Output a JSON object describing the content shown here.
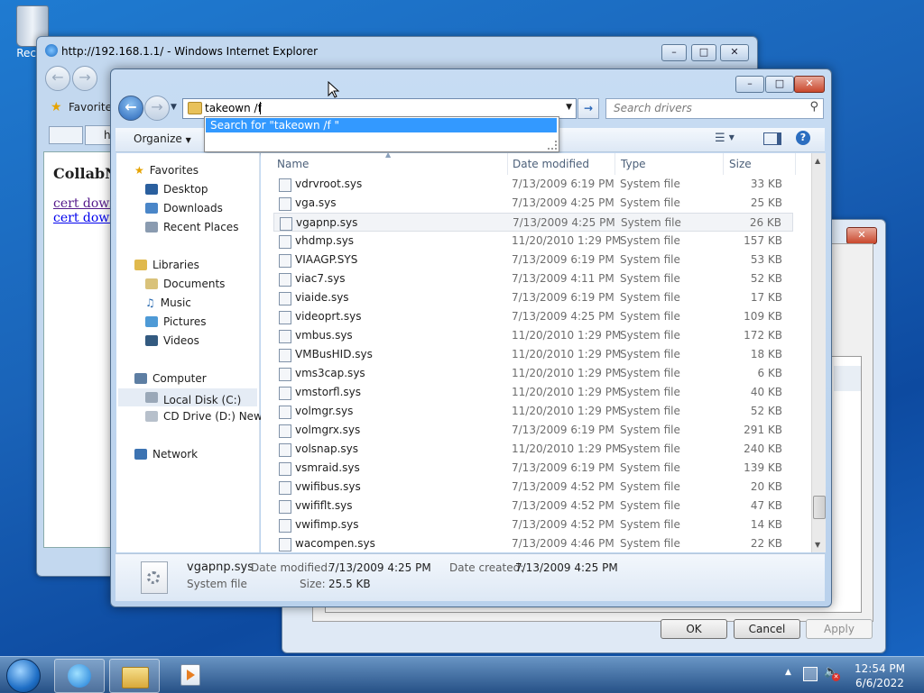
{
  "desktop": {
    "recycle_label": "Recyc"
  },
  "ie": {
    "title": "http://192.168.1.1/ - Windows Internet Explorer",
    "favorites_label": "Favorites",
    "tab_label": "h",
    "heading": "CollabN",
    "links": [
      "cert downl",
      "cert downl"
    ]
  },
  "props": {
    "ok": "OK",
    "cancel": "Cancel",
    "apply": "Apply"
  },
  "explorer": {
    "address_text": "takeown /f ",
    "search_placeholder": "Search drivers",
    "suggestion": "Search for \"takeown /f \"",
    "toolbar": {
      "organize": "Organize"
    },
    "nav": {
      "favorites": "Favorites",
      "desktop": "Desktop",
      "downloads": "Downloads",
      "recent": "Recent Places",
      "libraries": "Libraries",
      "documents": "Documents",
      "music": "Music",
      "pictures": "Pictures",
      "videos": "Videos",
      "computer": "Computer",
      "local_disk": "Local Disk (C:)",
      "cd_drive": "CD Drive (D:) New D",
      "network": "Network"
    },
    "columns": {
      "name": "Name",
      "date": "Date modified",
      "type": "Type",
      "size": "Size"
    },
    "files": [
      {
        "name": "vdrvroot.sys",
        "date": "7/13/2009 6:19 PM",
        "type": "System file",
        "size": "33 KB"
      },
      {
        "name": "vga.sys",
        "date": "7/13/2009 4:25 PM",
        "type": "System file",
        "size": "25 KB"
      },
      {
        "name": "vgapnp.sys",
        "date": "7/13/2009 4:25 PM",
        "type": "System file",
        "size": "26 KB"
      },
      {
        "name": "vhdmp.sys",
        "date": "11/20/2010 1:29 PM",
        "type": "System file",
        "size": "157 KB"
      },
      {
        "name": "VIAAGP.SYS",
        "date": "7/13/2009 6:19 PM",
        "type": "System file",
        "size": "53 KB"
      },
      {
        "name": "viac7.sys",
        "date": "7/13/2009 4:11 PM",
        "type": "System file",
        "size": "52 KB"
      },
      {
        "name": "viaide.sys",
        "date": "7/13/2009 6:19 PM",
        "type": "System file",
        "size": "17 KB"
      },
      {
        "name": "videoprt.sys",
        "date": "7/13/2009 4:25 PM",
        "type": "System file",
        "size": "109 KB"
      },
      {
        "name": "vmbus.sys",
        "date": "11/20/2010 1:29 PM",
        "type": "System file",
        "size": "172 KB"
      },
      {
        "name": "VMBusHID.sys",
        "date": "11/20/2010 1:29 PM",
        "type": "System file",
        "size": "18 KB"
      },
      {
        "name": "vms3cap.sys",
        "date": "11/20/2010 1:29 PM",
        "type": "System file",
        "size": "6 KB"
      },
      {
        "name": "vmstorfl.sys",
        "date": "11/20/2010 1:29 PM",
        "type": "System file",
        "size": "40 KB"
      },
      {
        "name": "volmgr.sys",
        "date": "11/20/2010 1:29 PM",
        "type": "System file",
        "size": "52 KB"
      },
      {
        "name": "volmgrx.sys",
        "date": "7/13/2009 6:19 PM",
        "type": "System file",
        "size": "291 KB"
      },
      {
        "name": "volsnap.sys",
        "date": "11/20/2010 1:29 PM",
        "type": "System file",
        "size": "240 KB"
      },
      {
        "name": "vsmraid.sys",
        "date": "7/13/2009 6:19 PM",
        "type": "System file",
        "size": "139 KB"
      },
      {
        "name": "vwifibus.sys",
        "date": "7/13/2009 4:52 PM",
        "type": "System file",
        "size": "20 KB"
      },
      {
        "name": "vwififlt.sys",
        "date": "7/13/2009 4:52 PM",
        "type": "System file",
        "size": "47 KB"
      },
      {
        "name": "vwifimp.sys",
        "date": "7/13/2009 4:52 PM",
        "type": "System file",
        "size": "14 KB"
      },
      {
        "name": "wacompen.sys",
        "date": "7/13/2009 4:46 PM",
        "type": "System file",
        "size": "22 KB"
      }
    ],
    "selected_index": 2,
    "details": {
      "filename": "vgapnp.sys",
      "filetype": "System file",
      "modified_label": "Date modified:",
      "modified_value": "7/13/2009 4:25 PM",
      "created_label": "Date created:",
      "created_value": "7/13/2009 4:25 PM",
      "size_label": "Size:",
      "size_value": "25.5 KB"
    }
  },
  "taskbar": {
    "time": "12:54 PM",
    "date": "6/6/2022"
  }
}
